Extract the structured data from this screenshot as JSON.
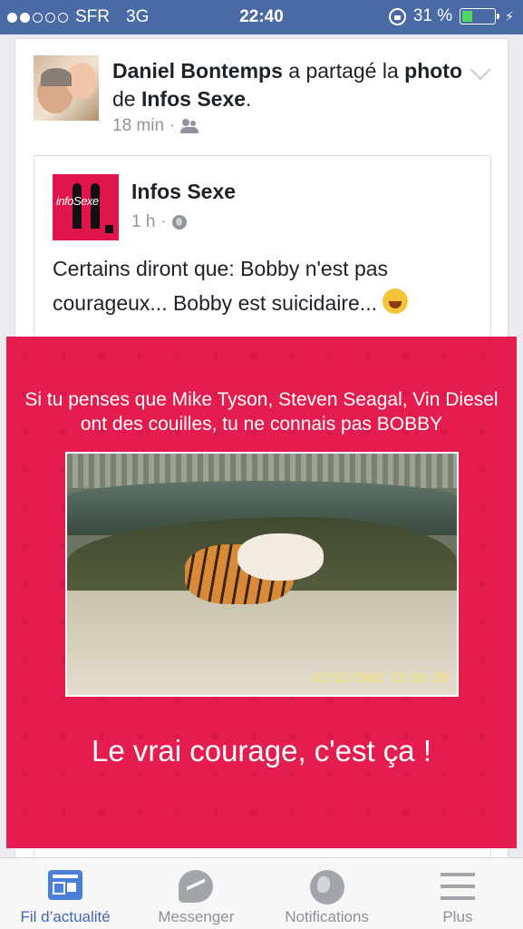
{
  "status_bar": {
    "carrier": "SFR",
    "network": "3G",
    "time": "22:40",
    "battery": "31 %",
    "battery_level": 0.31,
    "signal_bars": 2
  },
  "post": {
    "author": "Daniel Bontemps",
    "verb": "a partagé la",
    "object_bold": "photo",
    "preposition": "de",
    "page_ref": "Infos Sexe",
    "period": ".",
    "time": "18 min",
    "separator": "·",
    "privacy_icon": "friends-icon"
  },
  "shared_post": {
    "logo_text": "infoSexe",
    "page_name": "Infos Sexe",
    "time": "1 h",
    "separator": "·",
    "privacy_icon": "globe-icon",
    "text": "Certains diront que: Bobby n'est pas courageux... Bobby est suicidaire...",
    "emoji": "laughing-tears-emoji"
  },
  "image": {
    "caption_line1": "Si tu penses que Mike Tyson, Steven Seagal, Vin Diesel",
    "caption_line2": "ont des couilles, tu ne connais pas BOBBY",
    "photo_timestamp": "01/13/2002 12:20:28",
    "slogan": "Le vrai courage, c'est ça !",
    "background_color": "#e51d4f"
  },
  "tabbar": {
    "tabs": [
      {
        "label": "Fil d’actualité",
        "icon": "newsfeed-icon",
        "active": true
      },
      {
        "label": "Messenger",
        "icon": "messenger-icon",
        "active": false
      },
      {
        "label": "Notifications",
        "icon": "globe-icon",
        "active": false
      },
      {
        "label": "Plus",
        "icon": "menu-icon",
        "active": false
      }
    ]
  },
  "colors": {
    "status_bar": "#4a6aa5",
    "accent": "#4267b2",
    "inactive": "#8d9096"
  }
}
